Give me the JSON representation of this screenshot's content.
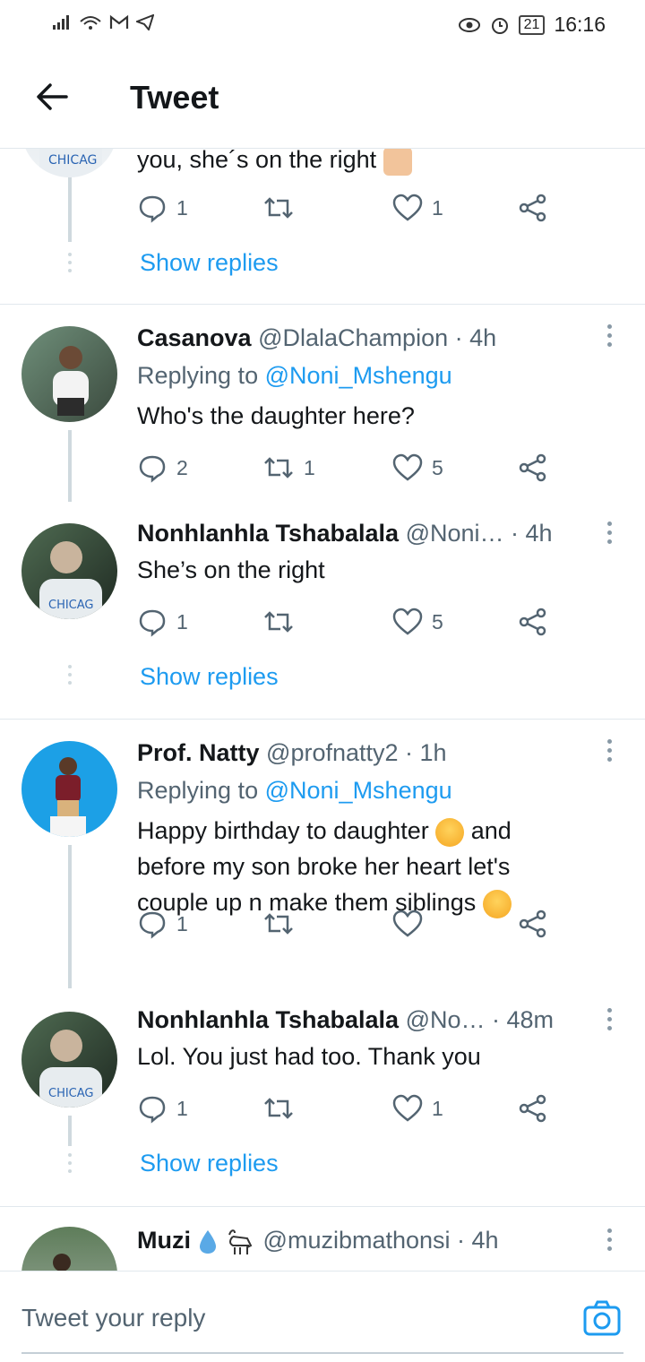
{
  "status": {
    "time": "16:16",
    "battery": "21"
  },
  "header": {
    "title": "Tweet"
  },
  "prev": {
    "text": "you, she´s on the right",
    "reply_count": "1",
    "retweet_count": "",
    "like_count": "1",
    "show_replies": "Show replies"
  },
  "tweets": [
    {
      "name": "Casanova",
      "handle": "@DlalaChampion · 4h",
      "replying_label": "Replying to",
      "replying_to": "@Noni_Mshengu",
      "text": "Who's the daughter here?",
      "reply_count": "2",
      "retweet_count": "1",
      "like_count": "5"
    },
    {
      "name": "Nonhlanhla Tshabalala",
      "handle": "@Noni… · 4h",
      "text": "She’s on the right",
      "reply_count": "1",
      "retweet_count": "",
      "like_count": "5",
      "show_replies": "Show replies"
    },
    {
      "name": "Prof. Natty",
      "handle": "@profnatty2 · 1h",
      "replying_label": "Replying to",
      "replying_to": "@Noni_Mshengu",
      "text_l1": "Happy birthday to daughter",
      "text_l1b": "and",
      "text_l2": "before my son broke her heart let's",
      "text_l3": "couple up n make them siblings",
      "reply_count": "1",
      "retweet_count": "",
      "like_count": ""
    },
    {
      "name": "Nonhlanhla Tshabalala",
      "handle": "@No… · 48m",
      "text": "Lol. You just had too. Thank you",
      "reply_count": "1",
      "retweet_count": "",
      "like_count": "1",
      "show_replies": "Show replies"
    },
    {
      "name": "Muzi",
      "handle": "@muzibmathonsi · 4h"
    }
  ],
  "reply_bar": {
    "placeholder": "Tweet your reply"
  },
  "colors": {
    "link": "#1d9bf0",
    "text": "#14171a",
    "muted": "#536471",
    "separator": "#e1e8ed"
  }
}
